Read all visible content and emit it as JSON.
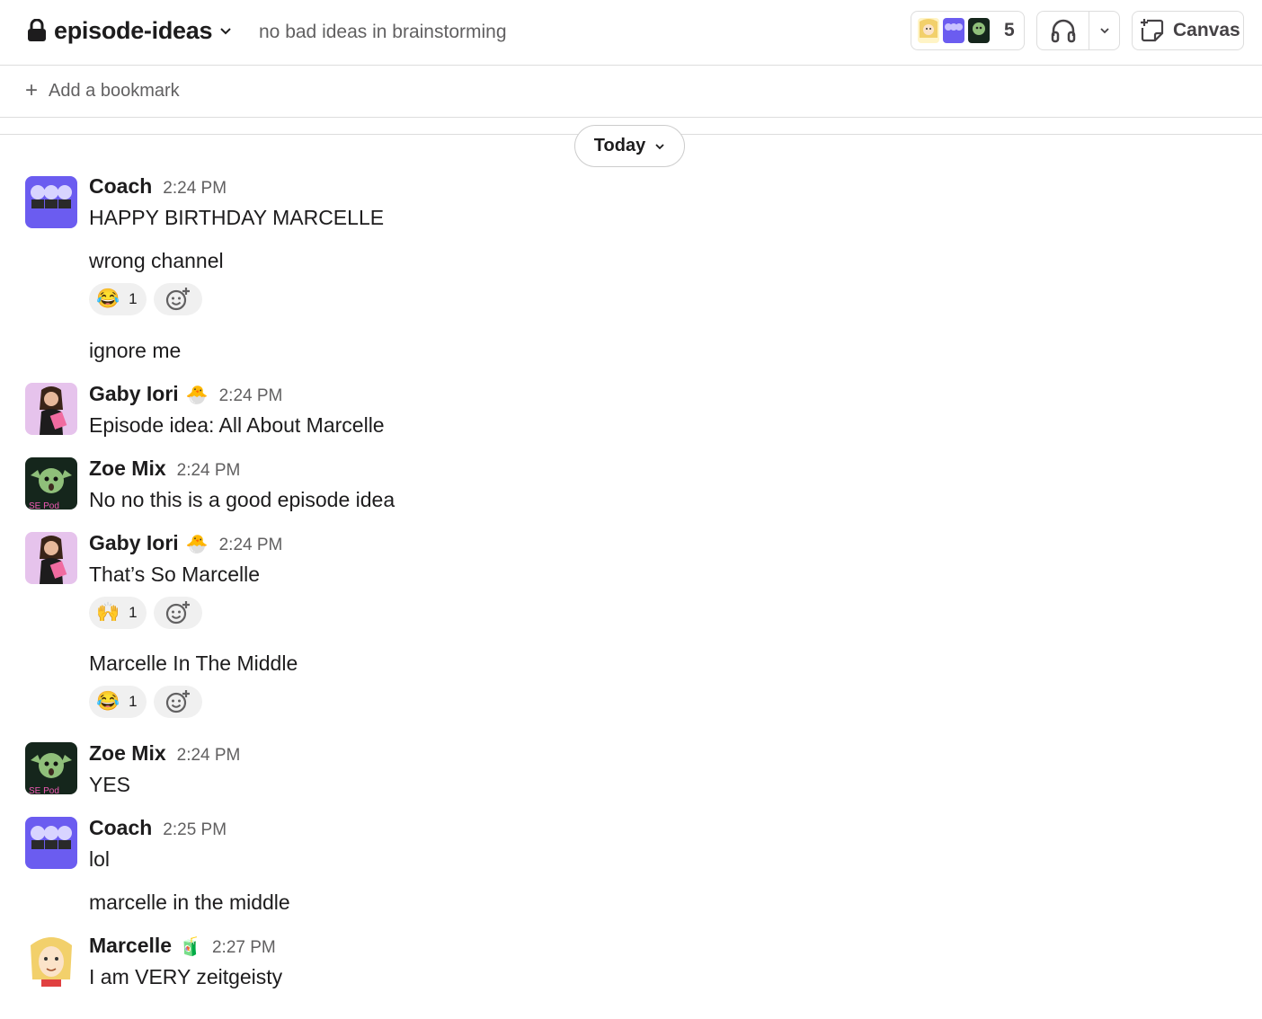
{
  "header": {
    "channel_name": "episode-ideas",
    "topic": "no bad ideas in brainstorming",
    "member_count": "5",
    "canvas_label": "Canvas"
  },
  "bookmarks": {
    "add_label": "Add a bookmark"
  },
  "divider": {
    "label": "Today"
  },
  "messages": [
    {
      "sender": "Coach",
      "time": "2:24 PM",
      "texts": [
        "HAPPY BIRTHDAY MARCELLE",
        "wrong channel",
        "ignore me"
      ],
      "reactions": [
        {
          "emoji": "😂",
          "count": "1"
        }
      ]
    },
    {
      "sender": "Gaby Iori",
      "status": "🐣",
      "time": "2:24 PM",
      "texts": [
        "Episode idea: All About Marcelle"
      ]
    },
    {
      "sender": "Zoe Mix",
      "time": "2:24 PM",
      "texts": [
        "No no this is a good episode idea"
      ]
    },
    {
      "sender": "Gaby Iori",
      "status": "🐣",
      "time": "2:24 PM",
      "texts": [
        "That’s So Marcelle",
        "Marcelle In The Middle"
      ],
      "reactions": [
        {
          "emoji": "🙌",
          "count": "1"
        },
        {
          "emoji": "😂",
          "count": "1"
        }
      ]
    },
    {
      "sender": "Zoe Mix",
      "time": "2:24 PM",
      "texts": [
        "YES"
      ]
    },
    {
      "sender": "Coach",
      "time": "2:25 PM",
      "texts": [
        "lol",
        "marcelle in the middle"
      ]
    },
    {
      "sender": "Marcelle",
      "status": "🧃",
      "time": "2:27 PM",
      "texts": [
        "I am VERY zeitgeisty"
      ]
    }
  ],
  "icons": {
    "lock": "lock-icon",
    "chevron": "chevron-down-icon",
    "huddle": "headphones-icon",
    "canvas": "canvas-icon",
    "add_reaction": "add-reaction-icon"
  },
  "colors": {
    "coach_avatar": "#6b5cf0",
    "gaby_avatar": "#e6c3ec",
    "zoe_avatar": "#1f3a2a",
    "marcelle_avatar": "#fff4c6"
  }
}
